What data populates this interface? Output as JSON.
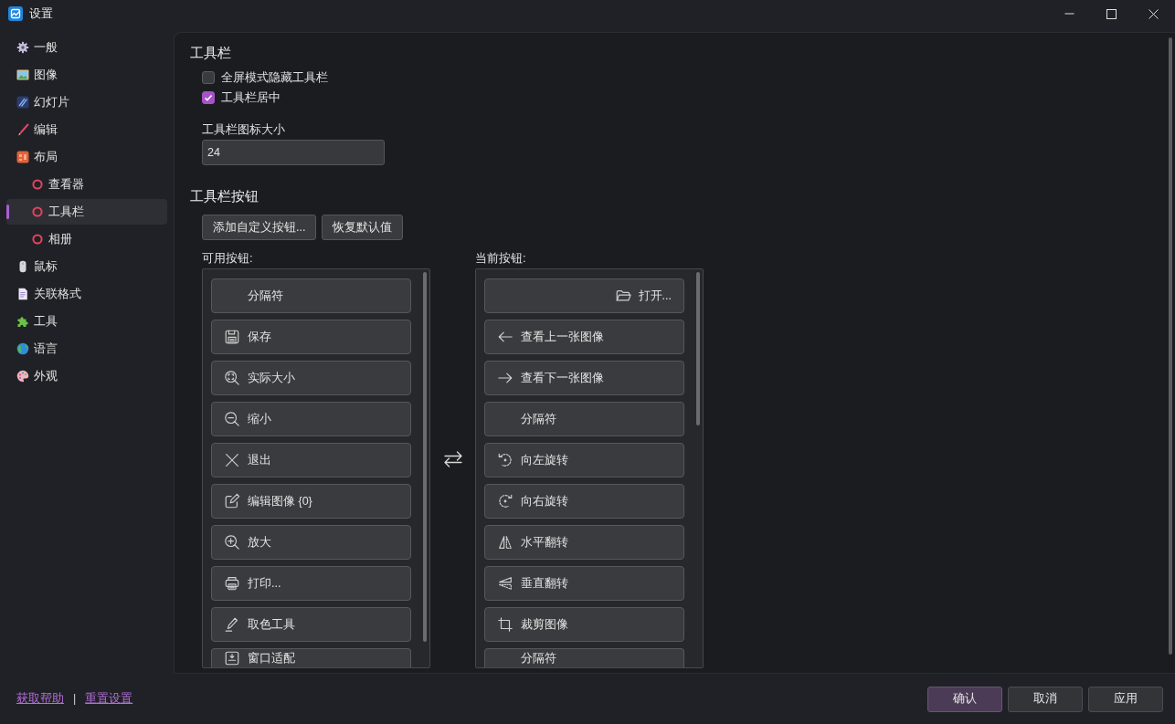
{
  "window": {
    "title": "设置"
  },
  "sidebar": {
    "items": [
      {
        "label": "一般",
        "selected": false
      },
      {
        "label": "图像",
        "selected": false
      },
      {
        "label": "幻灯片",
        "selected": false
      },
      {
        "label": "编辑",
        "selected": false
      },
      {
        "label": "布局",
        "selected": false,
        "children": [
          {
            "label": "查看器",
            "selected": false
          },
          {
            "label": "工具栏",
            "selected": true
          },
          {
            "label": "相册",
            "selected": false
          }
        ]
      },
      {
        "label": "鼠标",
        "selected": false
      },
      {
        "label": "关联格式",
        "selected": false
      },
      {
        "label": "工具",
        "selected": false
      },
      {
        "label": "语言",
        "selected": false
      },
      {
        "label": "外观",
        "selected": false
      }
    ]
  },
  "toolbar": {
    "heading": "工具栏",
    "checkboxes": [
      {
        "label": "全屏模式隐藏工具栏",
        "checked": false
      },
      {
        "label": "工具栏居中",
        "checked": true
      }
    ],
    "icon_size": {
      "label": "工具栏图标大小",
      "value": "24"
    }
  },
  "toolbar_buttons": {
    "heading": "工具栏按钮",
    "actions": [
      {
        "label": "添加自定义按钮..."
      },
      {
        "label": "恢复默认值"
      }
    ],
    "available": {
      "label": "可用按钮:",
      "items": [
        {
          "label": "分隔符",
          "kind": "separator"
        },
        {
          "label": "保存",
          "kind": "button"
        },
        {
          "label": "实际大小",
          "kind": "button"
        },
        {
          "label": "缩小",
          "kind": "button"
        },
        {
          "label": "退出",
          "kind": "button"
        },
        {
          "label": "编辑图像 {0}",
          "kind": "button"
        },
        {
          "label": "放大",
          "kind": "button"
        },
        {
          "label": "打印...",
          "kind": "button"
        },
        {
          "label": "取色工具",
          "kind": "button"
        },
        {
          "label": "窗口适配",
          "kind": "button"
        }
      ]
    },
    "current": {
      "label": "当前按钮:",
      "items": [
        {
          "label": "打开...",
          "kind": "right_aligned"
        },
        {
          "label": "查看上一张图像",
          "kind": "button"
        },
        {
          "label": "查看下一张图像",
          "kind": "button"
        },
        {
          "label": "分隔符",
          "kind": "separator"
        },
        {
          "label": "向左旋转",
          "kind": "button"
        },
        {
          "label": "向右旋转",
          "kind": "button"
        },
        {
          "label": "水平翻转",
          "kind": "button"
        },
        {
          "label": "垂直翻转",
          "kind": "button"
        },
        {
          "label": "裁剪图像",
          "kind": "button"
        },
        {
          "label": "分隔符",
          "kind": "separator"
        }
      ]
    }
  },
  "footer": {
    "links": [
      "获取帮助",
      "重置设置"
    ],
    "separator": "|",
    "buttons": [
      {
        "label": "确认",
        "kind": "primary"
      },
      {
        "label": "取消",
        "kind": "normal"
      },
      {
        "label": "应用",
        "kind": "normal"
      }
    ]
  }
}
